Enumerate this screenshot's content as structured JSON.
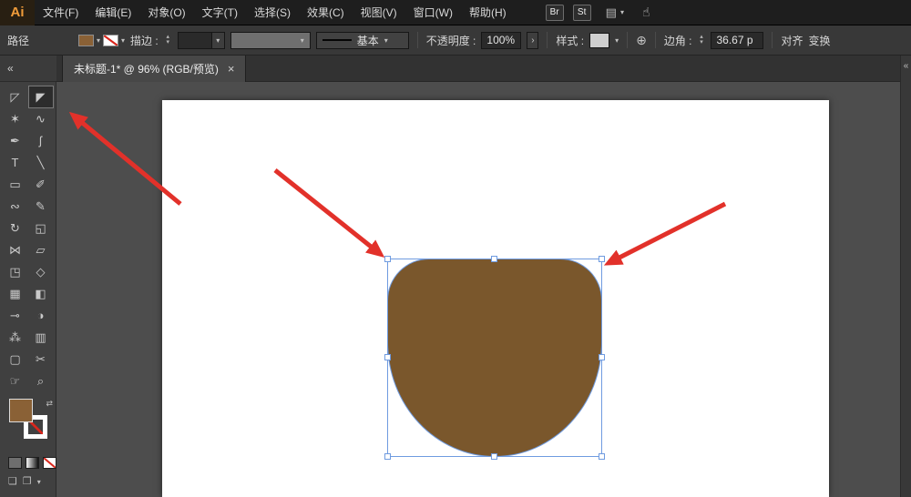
{
  "colors": {
    "shape_fill": "#7a572c",
    "fill_swatch": "#8a6136",
    "selection": "#6f9be0",
    "arrow": "#e2312a"
  },
  "icons": {
    "chevron_down": "▾",
    "stepper_up": "▴",
    "stepper_down": "▾",
    "collapse_left": "«",
    "globe": "⊕",
    "panel_arrow": "›",
    "workspace": "▤",
    "gesture": "☝",
    "swap": "⇄",
    "draw_mode_a": "❏",
    "draw_mode_b": "❐",
    "draw_mode_chevron": "▾",
    "close": "×"
  },
  "menubar": {
    "logo": "Ai",
    "items": [
      {
        "name": "menu-file",
        "label": "文件(F)"
      },
      {
        "name": "menu-edit",
        "label": "编辑(E)"
      },
      {
        "name": "menu-object",
        "label": "对象(O)"
      },
      {
        "name": "menu-type",
        "label": "文字(T)"
      },
      {
        "name": "menu-select",
        "label": "选择(S)"
      },
      {
        "name": "menu-effect",
        "label": "效果(C)"
      },
      {
        "name": "menu-view",
        "label": "视图(V)"
      },
      {
        "name": "menu-window",
        "label": "窗口(W)"
      },
      {
        "name": "menu-help",
        "label": "帮助(H)"
      }
    ],
    "br_badge": "Br",
    "st_badge": "St"
  },
  "controlbar": {
    "path_label": "路径",
    "stroke_label": "描边 :",
    "profile_value": "基本",
    "opacity_label": "不透明度 :",
    "opacity_value": "100%",
    "style_label": "样式 :",
    "corner_label": "边角 :",
    "corner_value": "36.67 p",
    "align_label": "对齐",
    "transform_label": "变换"
  },
  "tabbar": {
    "title": "未标题-1* @ 96% (RGB/预览)"
  },
  "toolbar": {
    "tools": [
      {
        "name": "selection-tool",
        "glyph": "◸"
      },
      {
        "name": "direct-selection-tool",
        "glyph": "◤",
        "active": true
      },
      {
        "name": "magic-wand-tool",
        "glyph": "✶"
      },
      {
        "name": "lasso-tool",
        "glyph": "∿"
      },
      {
        "name": "pen-tool",
        "glyph": "✒"
      },
      {
        "name": "curvature-tool",
        "glyph": "ʃ"
      },
      {
        "name": "type-tool",
        "glyph": "T"
      },
      {
        "name": "line-segment-tool",
        "glyph": "╲"
      },
      {
        "name": "rectangle-tool",
        "glyph": "▭"
      },
      {
        "name": "paintbrush-tool",
        "glyph": "✐"
      },
      {
        "name": "shaper-tool",
        "glyph": "∾"
      },
      {
        "name": "pencil-tool",
        "glyph": "✎"
      },
      {
        "name": "rotate-tool",
        "glyph": "↻"
      },
      {
        "name": "scale-tool",
        "glyph": "◱"
      },
      {
        "name": "width-tool",
        "glyph": "⋈"
      },
      {
        "name": "free-transform-tool",
        "glyph": "▱"
      },
      {
        "name": "shape-builder-tool",
        "glyph": "◳"
      },
      {
        "name": "perspective-grid-tool",
        "glyph": "◇"
      },
      {
        "name": "mesh-tool",
        "glyph": "▦"
      },
      {
        "name": "gradient-tool",
        "glyph": "◧"
      },
      {
        "name": "eyedropper-tool",
        "glyph": "⊸"
      },
      {
        "name": "blend-tool",
        "glyph": "◑"
      },
      {
        "name": "symbol-sprayer-tool",
        "glyph": "⁂"
      },
      {
        "name": "column-graph-tool",
        "glyph": "▥"
      },
      {
        "name": "artboard-tool",
        "glyph": "▢"
      },
      {
        "name": "slice-tool",
        "glyph": "✂"
      },
      {
        "name": "hand-tool",
        "glyph": "☞"
      },
      {
        "name": "zoom-tool",
        "glyph": "⌕"
      }
    ]
  }
}
